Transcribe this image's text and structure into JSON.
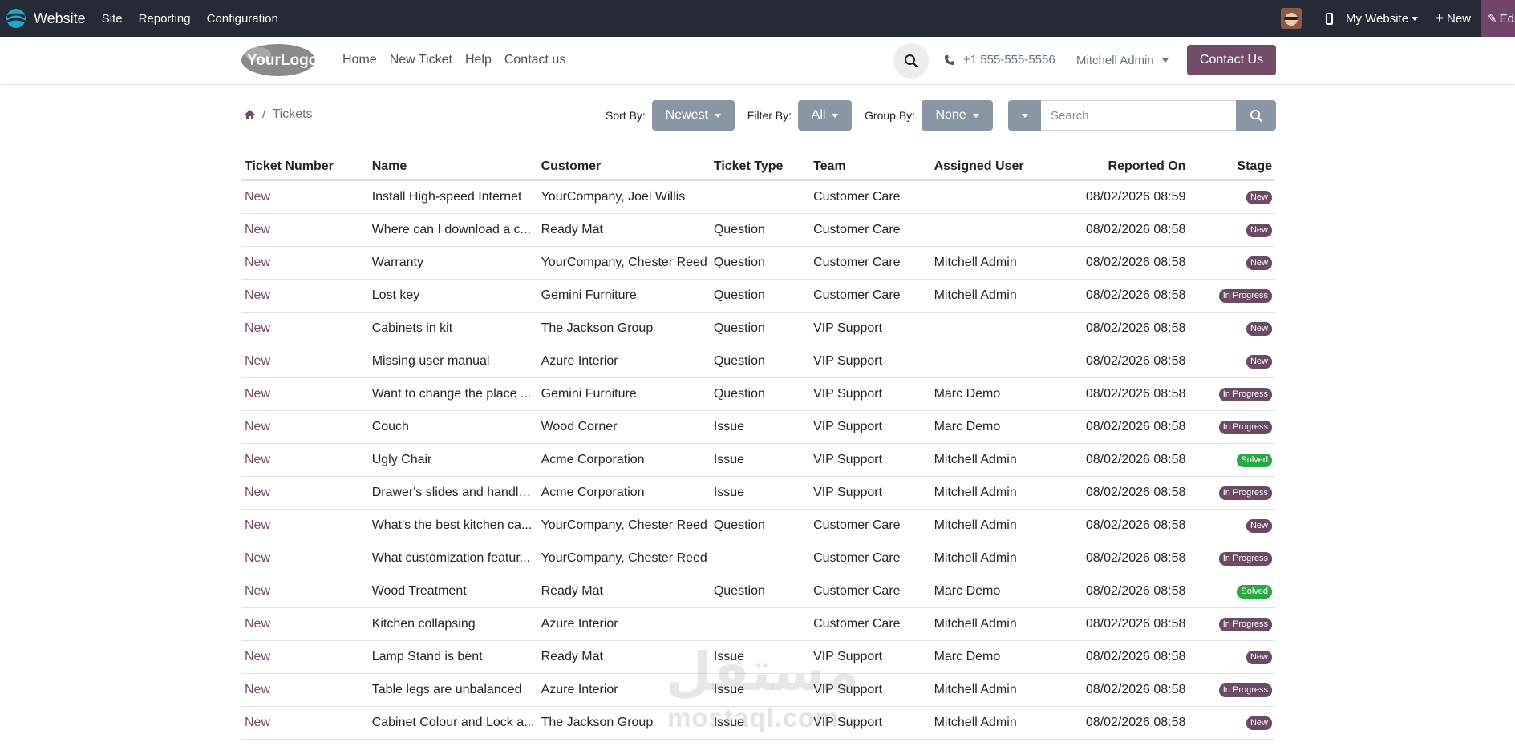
{
  "admin_bar": {
    "app_name": "Website",
    "menu": [
      "Site",
      "Reporting",
      "Configuration"
    ],
    "my_website": "My Website",
    "new_label": "New",
    "edit_label": "Edit",
    "bg_color": "#262a36",
    "edit_color": "#71446a"
  },
  "site_header": {
    "logo_text": "YourLogo",
    "nav": [
      "Home",
      "New Ticket",
      "Help",
      "Contact us"
    ],
    "phone": "+1 555-555-5556",
    "user": "Mitchell Admin",
    "contact_button": "Contact Us",
    "brand_color": "#714b67"
  },
  "toolbar": {
    "breadcrumb_sep": "/",
    "breadcrumb_current": "Tickets",
    "sort_label": "Sort By:",
    "sort_value": "Newest",
    "filter_label": "Filter By:",
    "filter_value": "All",
    "group_label": "Group By:",
    "group_value": "None",
    "search_placeholder": "Search"
  },
  "table": {
    "headers": {
      "ticket_number": "Ticket Number",
      "name": "Name",
      "customer": "Customer",
      "ticket_type": "Ticket Type",
      "team": "Team",
      "assigned_user": "Assigned User",
      "reported_on": "Reported On",
      "stage": "Stage"
    },
    "stage_colors": {
      "New": "#6b4a64",
      "In Progress": "#6b4a64",
      "Solved": "#28a745"
    },
    "rows": [
      {
        "number": "New",
        "name": "Install High-speed Internet",
        "customer": "YourCompany, Joel Willis",
        "type": "",
        "team": "Customer Care",
        "user": "",
        "reported": "08/02/2026 08:59",
        "stage": "New"
      },
      {
        "number": "New",
        "name": "Where can I download a c...",
        "customer": "Ready Mat",
        "type": "Question",
        "team": "Customer Care",
        "user": "",
        "reported": "08/02/2026 08:58",
        "stage": "New"
      },
      {
        "number": "New",
        "name": "Warranty",
        "customer": "YourCompany, Chester Reed",
        "type": "Question",
        "team": "Customer Care",
        "user": "Mitchell Admin",
        "reported": "08/02/2026 08:58",
        "stage": "New"
      },
      {
        "number": "New",
        "name": "Lost key",
        "customer": "Gemini Furniture",
        "type": "Question",
        "team": "Customer Care",
        "user": "Mitchell Admin",
        "reported": "08/02/2026 08:58",
        "stage": "In Progress"
      },
      {
        "number": "New",
        "name": "Cabinets in kit",
        "customer": "The Jackson Group",
        "type": "Question",
        "team": "VIP Support",
        "user": "",
        "reported": "08/02/2026 08:58",
        "stage": "New"
      },
      {
        "number": "New",
        "name": "Missing user manual",
        "customer": "Azure Interior",
        "type": "Question",
        "team": "VIP Support",
        "user": "",
        "reported": "08/02/2026 08:58",
        "stage": "New"
      },
      {
        "number": "New",
        "name": "Want to change the place ...",
        "customer": "Gemini Furniture",
        "type": "Question",
        "team": "VIP Support",
        "user": "Marc Demo",
        "reported": "08/02/2026 08:58",
        "stage": "In Progress"
      },
      {
        "number": "New",
        "name": "Couch",
        "customer": "Wood Corner",
        "type": "Issue",
        "team": "VIP Support",
        "user": "Marc Demo",
        "reported": "08/02/2026 08:58",
        "stage": "In Progress"
      },
      {
        "number": "New",
        "name": "Ugly Chair",
        "customer": "Acme Corporation",
        "type": "Issue",
        "team": "VIP Support",
        "user": "Mitchell Admin",
        "reported": "08/02/2026 08:58",
        "stage": "Solved"
      },
      {
        "number": "New",
        "name": "Drawer's slides and handle...",
        "customer": "Acme Corporation",
        "type": "Issue",
        "team": "VIP Support",
        "user": "Mitchell Admin",
        "reported": "08/02/2026 08:58",
        "stage": "In Progress"
      },
      {
        "number": "New",
        "name": "What's the best kitchen ca...",
        "customer": "YourCompany, Chester Reed",
        "type": "Question",
        "team": "Customer Care",
        "user": "Mitchell Admin",
        "reported": "08/02/2026 08:58",
        "stage": "New"
      },
      {
        "number": "New",
        "name": "What customization featur...",
        "customer": "YourCompany, Chester Reed",
        "type": "",
        "team": "Customer Care",
        "user": "Mitchell Admin",
        "reported": "08/02/2026 08:58",
        "stage": "In Progress"
      },
      {
        "number": "New",
        "name": "Wood Treatment",
        "customer": "Ready Mat",
        "type": "Question",
        "team": "Customer Care",
        "user": "Marc Demo",
        "reported": "08/02/2026 08:58",
        "stage": "Solved"
      },
      {
        "number": "New",
        "name": "Kitchen collapsing",
        "customer": "Azure Interior",
        "type": "",
        "team": "Customer Care",
        "user": "Mitchell Admin",
        "reported": "08/02/2026 08:58",
        "stage": "In Progress"
      },
      {
        "number": "New",
        "name": "Lamp Stand is bent",
        "customer": "Ready Mat",
        "type": "Issue",
        "team": "VIP Support",
        "user": "Marc Demo",
        "reported": "08/02/2026 08:58",
        "stage": "New"
      },
      {
        "number": "New",
        "name": "Table legs are unbalanced",
        "customer": "Azure Interior",
        "type": "Issue",
        "team": "VIP Support",
        "user": "Mitchell Admin",
        "reported": "08/02/2026 08:58",
        "stage": "In Progress"
      },
      {
        "number": "New",
        "name": "Cabinet Colour and Lock a...",
        "customer": "The Jackson Group",
        "type": "Issue",
        "team": "VIP Support",
        "user": "Mitchell Admin",
        "reported": "08/02/2026 08:58",
        "stage": "New"
      }
    ]
  },
  "watermark": {
    "arabic": "مستقل",
    "latin": "mostaql.com"
  }
}
